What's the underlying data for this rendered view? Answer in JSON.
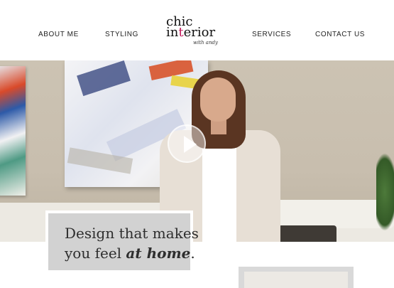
{
  "header": {
    "nav_left": [
      "ABOUT ME",
      "STYLING"
    ],
    "nav_right": [
      "SERVICES",
      "CONTACT US"
    ],
    "logo": {
      "line1": "chic",
      "line2_prefix": "in",
      "line2_accent": "t",
      "line2_suffix": "erior",
      "tagline": "with andy"
    }
  },
  "hero": {
    "video": {
      "play_icon": "play-icon"
    }
  },
  "tagline": {
    "line1": "Design that makes",
    "line2_prefix": "you feel ",
    "line2_emphasis": "at home",
    "line2_suffix": "."
  },
  "colors": {
    "accent": "#c2185b",
    "tagline_bg": "#d2d2d2",
    "text": "#2e2e2e"
  }
}
